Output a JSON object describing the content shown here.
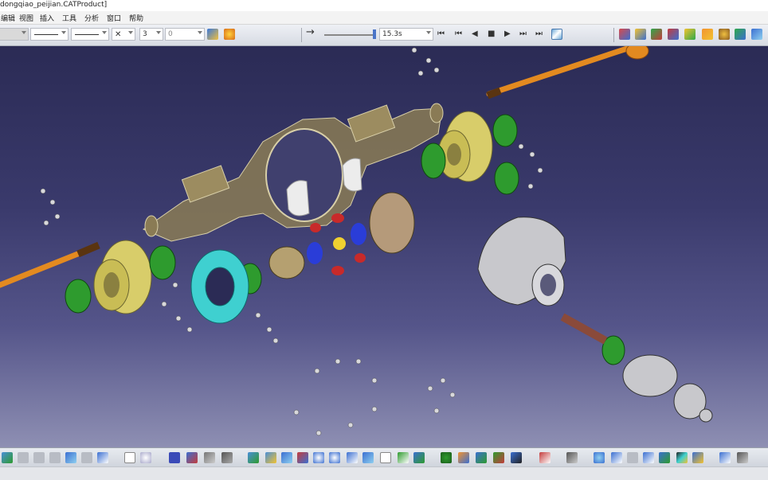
{
  "window": {
    "title": "dongqiao_peijian.CATProduct]"
  },
  "menu": {
    "items": [
      "编辑",
      "视图",
      "插入",
      "工具",
      "分析",
      "窗口",
      "帮助"
    ]
  },
  "toolbar": {
    "dimension_value": "3",
    "number_value": "0",
    "animation_time": "15.3s",
    "player_buttons": [
      "⏮",
      "⏮",
      "◀",
      "■",
      "▶",
      "⏭",
      "⏭"
    ]
  },
  "colors": {
    "background_top": "#2b2b55",
    "background_bottom": "#8e8fb3",
    "housing": "#8a7b55",
    "shaft": "#e38a20",
    "bearing": "#2e9b2e",
    "bevel_gear": "#3fd0d0",
    "hub": "#d8cd6a",
    "cover": "#c8c8cc"
  },
  "icons": {
    "top_right": [
      "product-icon",
      "assembly-icon",
      "constraint-icon",
      "explode-icon",
      "snap-icon",
      "move-icon",
      "compass-icon",
      "manipulate-icon",
      "fit-icon",
      "normal-view-icon"
    ],
    "bottom": [
      "update-icon",
      "cut-icon",
      "copy-icon",
      "paste-icon",
      "undo-icon",
      "redo-icon",
      "help-icon",
      "formula-icon",
      "comment-icon",
      "pan-icon",
      "rotate-icon",
      "zoom-in-icon",
      "zoom-out-icon",
      "view-icon",
      "render-icon"
    ]
  }
}
